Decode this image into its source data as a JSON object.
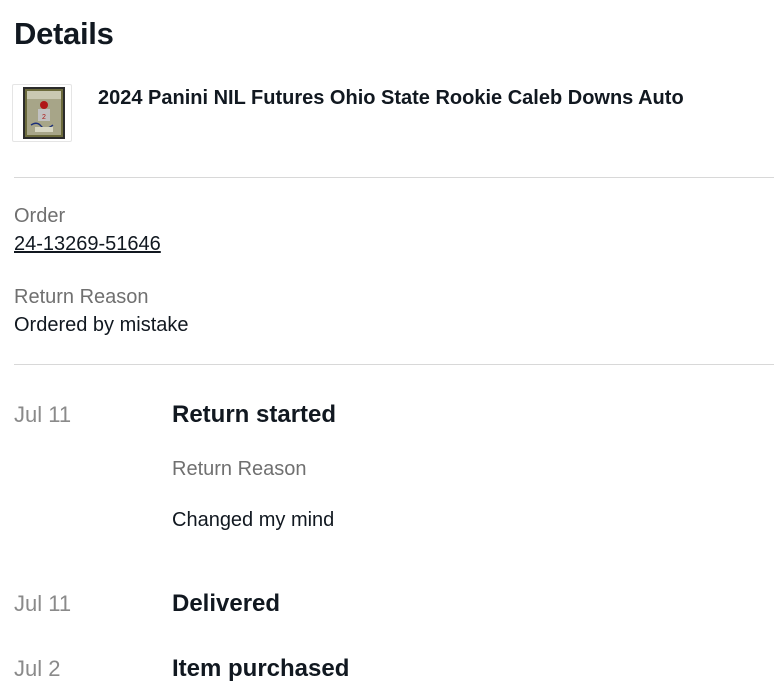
{
  "header": {
    "title": "Details"
  },
  "item": {
    "title": "2024 Panini NIL Futures Ohio State Rookie Caleb Downs Auto",
    "thumbnail_icon": "trading-card-thumbnail"
  },
  "order": {
    "label": "Order",
    "number": "24-13269-51646"
  },
  "return_reason": {
    "label": "Return Reason",
    "value": "Ordered by mistake"
  },
  "timeline": [
    {
      "date": "Jul 11",
      "event": "Return started",
      "detail_label": "Return Reason",
      "detail_value": "Changed my mind"
    },
    {
      "date": "Jul 11",
      "event": "Delivered"
    },
    {
      "date": "Jul 2",
      "event": "Item purchased"
    }
  ],
  "colors": {
    "text": "#111820",
    "muted": "#707070",
    "date": "#8a8a8a",
    "divider": "#d8d8d8"
  }
}
